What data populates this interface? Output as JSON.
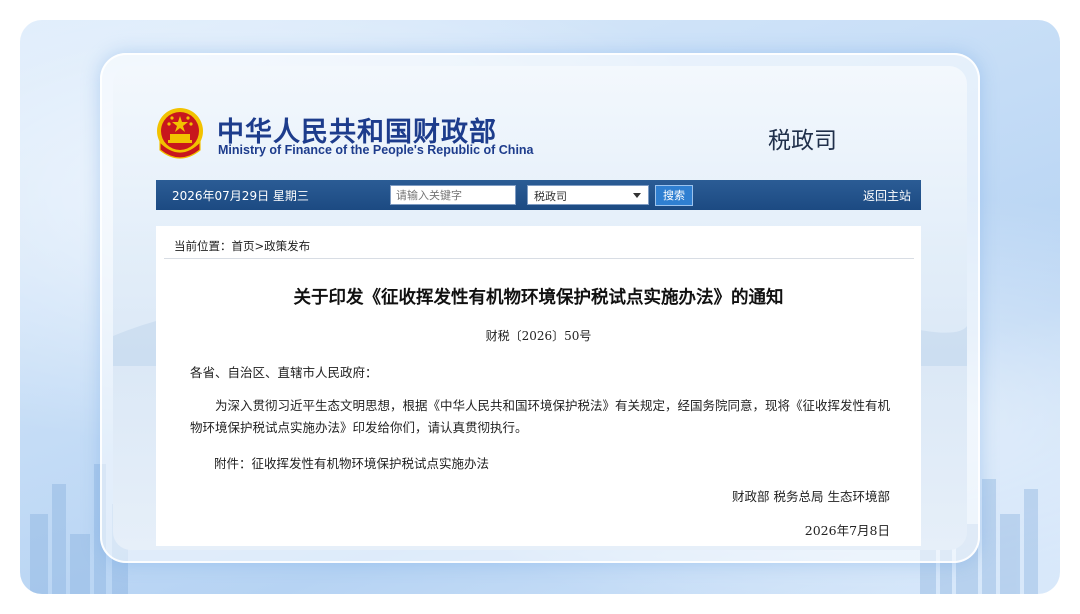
{
  "header": {
    "ministry_cn": "中华人民共和国财政部",
    "ministry_en": "Ministry of Finance of the People's Republic of China",
    "department": "税政司"
  },
  "navbar": {
    "date": "2026年07月29日  星期三",
    "search_placeholder": "请输入关键字",
    "select_value": "税政司",
    "search_button": "搜索",
    "home_link": "返回主站"
  },
  "breadcrumb": "当前位置：首页>政策发布",
  "document": {
    "title": "关于印发《征收挥发性有机物环境保护税试点实施办法》的通知",
    "number": "财税〔2026〕50号",
    "addressee": "各省、自治区、直辖市人民政府：",
    "body": "为深入贯彻习近平生态文明思想，根据《中华人民共和国环境保护税法》有关规定，经国务院同意，现将《征收挥发性有机物环境保护税试点实施办法》印发给你们，请认真贯彻执行。",
    "attachment": "附件：征收挥发性有机物环境保护税试点实施办法",
    "issuers": "财政部  税务总局  生态环境部",
    "date": "2026年7月8日"
  },
  "colors": {
    "navbar": "#1c4a82",
    "brand_blue": "#1d3c8c",
    "emblem_red": "#c8161d",
    "emblem_gold": "#f2c200"
  }
}
